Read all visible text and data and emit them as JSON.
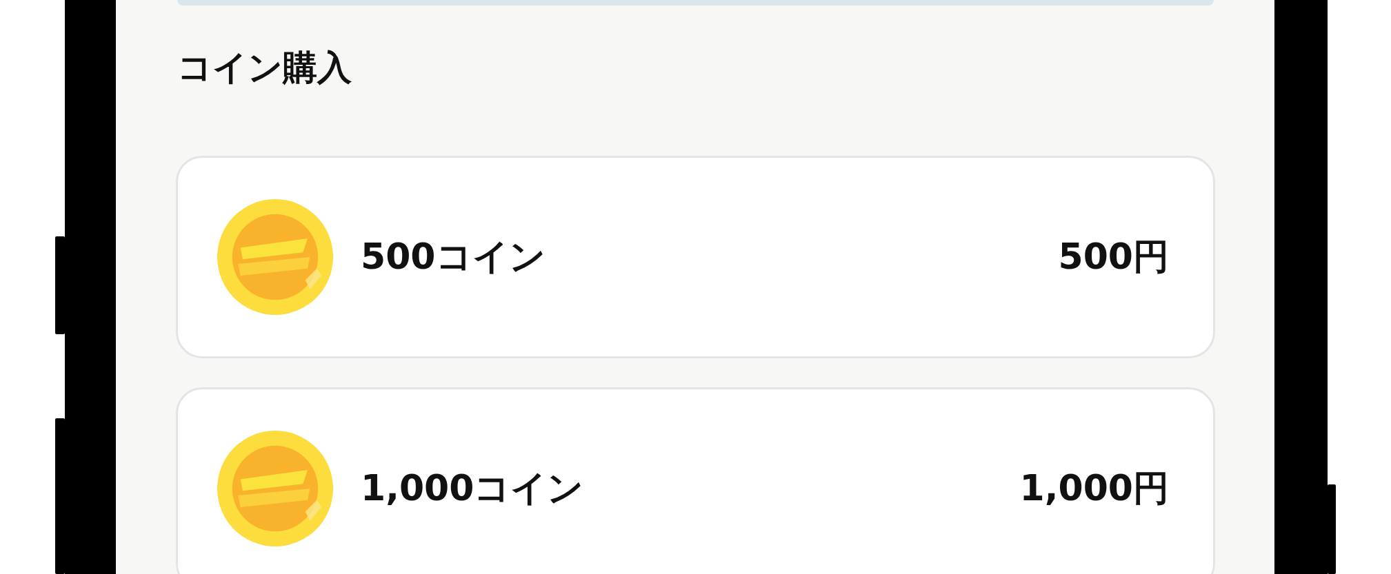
{
  "section_title": "コイン購入",
  "packages": [
    {
      "coins": "500コイン",
      "price": "500円"
    },
    {
      "coins": "1,000コイン",
      "price": "1,000円"
    }
  ]
}
